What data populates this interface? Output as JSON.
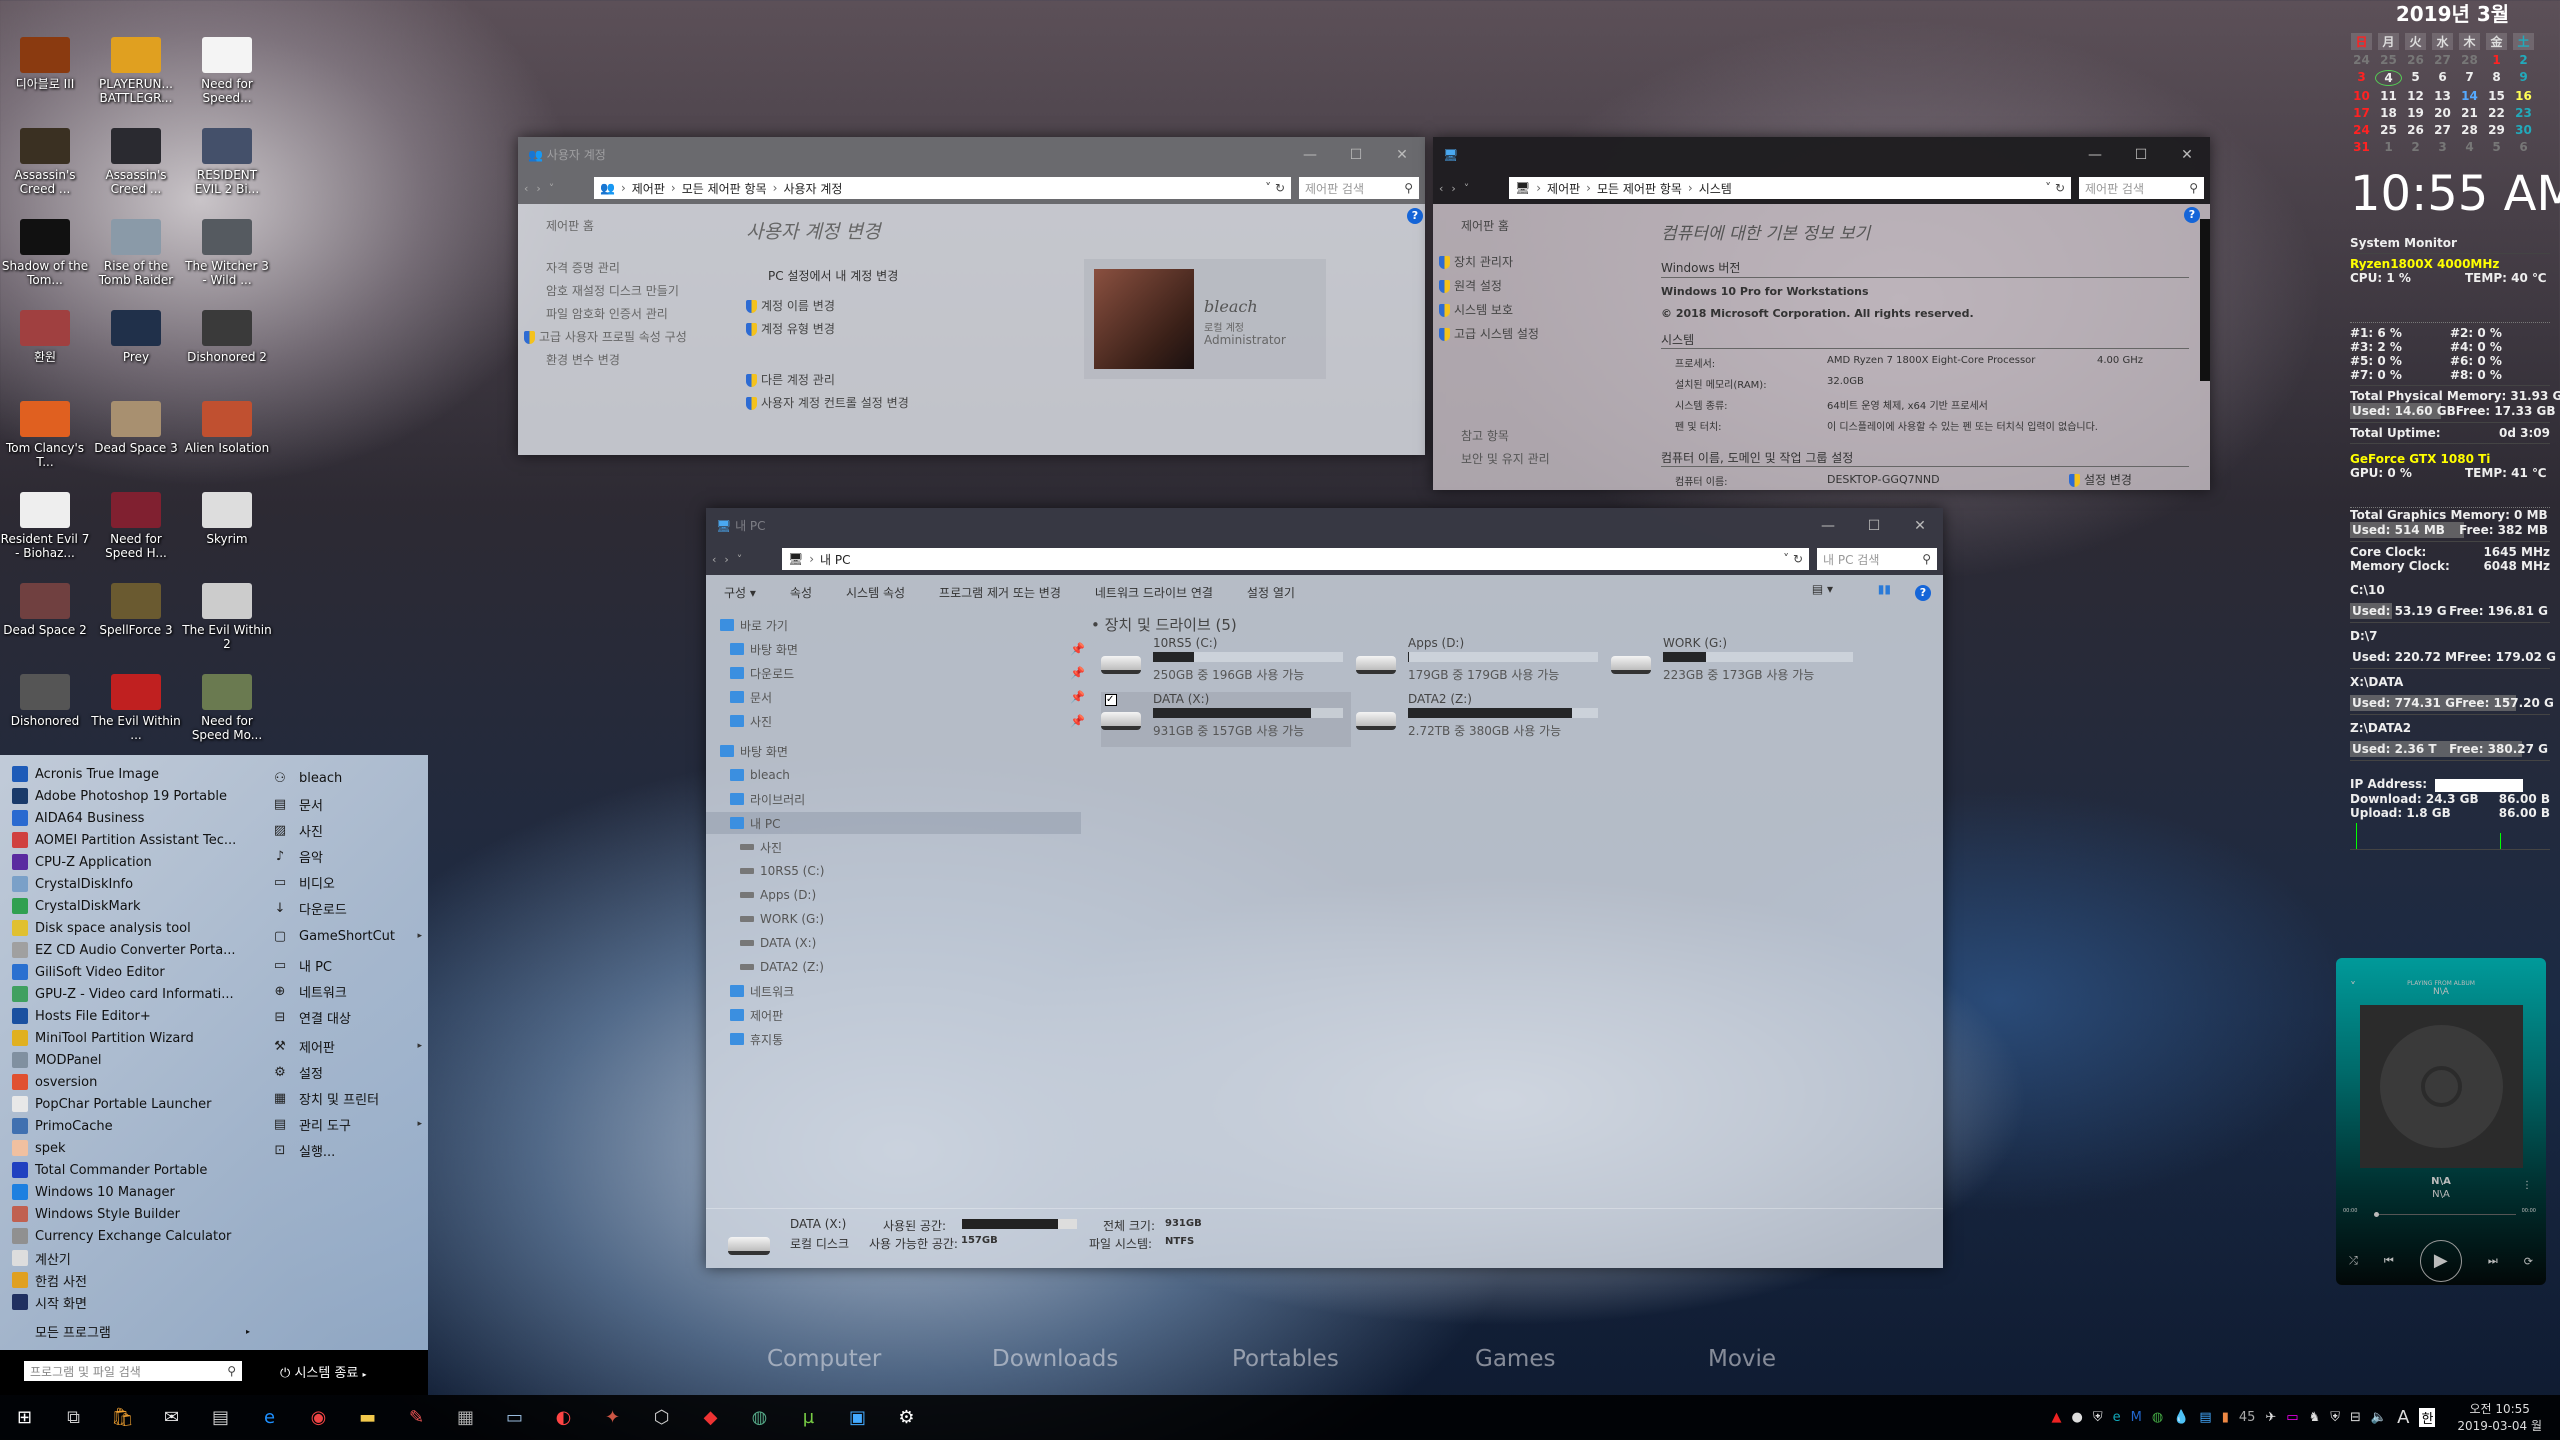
{
  "desktop_icons": [
    {
      "label": "디아블로 III",
      "color": "#8a3a10"
    },
    {
      "label": "PLAYERUN... BATTLEGR...",
      "color": "#e0a020"
    },
    {
      "label": "Need for Speed...",
      "color": "#f4f4f4"
    },
    {
      "label": "Assassin's Creed ...",
      "color": "#3a3022"
    },
    {
      "label": "Assassin's Creed ...",
      "color": "#2a2a30"
    },
    {
      "label": "RESIDENT EVIL 2 Bi...",
      "color": "#44506a"
    },
    {
      "label": "Shadow of the Tom...",
      "color": "#111111"
    },
    {
      "label": "Rise of the Tomb Raider",
      "color": "#8a9aa8"
    },
    {
      "label": "The Witcher 3 - Wild ...",
      "color": "#555a60"
    },
    {
      "label": "환원",
      "color": "#a04040"
    },
    {
      "label": "Prey",
      "color": "#20304a"
    },
    {
      "label": "Dishonored 2",
      "color": "#3a3a3a"
    },
    {
      "label": "Tom Clancy's T...",
      "color": "#e06020"
    },
    {
      "label": "Dead Space 3",
      "color": "#a89070"
    },
    {
      "label": "Alien Isolation",
      "color": "#c05030"
    },
    {
      "label": "Resident Evil 7 - Biohaz...",
      "color": "#eeeeee"
    },
    {
      "label": "Need for Speed H...",
      "color": "#802030"
    },
    {
      "label": "Skyrim",
      "color": "#dddddd"
    },
    {
      "label": "Dead Space 2",
      "color": "#704040"
    },
    {
      "label": "SpellForce 3",
      "color": "#6a5a30"
    },
    {
      "label": "The Evil Within 2",
      "color": "#cccccc"
    },
    {
      "label": "Dishonored",
      "color": "#555555"
    },
    {
      "label": "The Evil Within ...",
      "color": "#c02020"
    },
    {
      "label": "Need for Speed Mo...",
      "color": "#6a7a50"
    }
  ],
  "desktop_labels": [
    "Computer",
    "Downloads",
    "Portables",
    "Games",
    "Movie"
  ],
  "start_menu": {
    "programs": [
      {
        "label": "Acronis True Image",
        "color": "#1e5bb8"
      },
      {
        "label": "Adobe Photoshop 19 Portable",
        "color": "#1a3a6a"
      },
      {
        "label": "AIDA64 Business",
        "color": "#2a6ad0"
      },
      {
        "label": "AOMEI Partition Assistant Tec...",
        "color": "#d04040"
      },
      {
        "label": "CPU-Z Application",
        "color": "#5a2aa0"
      },
      {
        "label": "CrystalDiskInfo",
        "color": "#7aa0c8"
      },
      {
        "label": "CrystalDiskMark",
        "color": "#30a050"
      },
      {
        "label": "Disk space analysis tool",
        "color": "#e0c030"
      },
      {
        "label": "EZ CD Audio Converter Porta...",
        "color": "#a0a0a0"
      },
      {
        "label": "GiliSoft Video Editor",
        "color": "#2a70d0"
      },
      {
        "label": "GPU-Z - Video card Informati...",
        "color": "#40a060"
      },
      {
        "label": "Hosts File Editor+",
        "color": "#1a50a0"
      },
      {
        "label": "MiniTool Partition Wizard",
        "color": "#e0b020"
      },
      {
        "label": "MODPanel",
        "color": "#8090a0"
      },
      {
        "label": "osversion",
        "color": "#e05030"
      },
      {
        "label": "PopChar Portable Launcher",
        "color": "#e8e8e8"
      },
      {
        "label": "PrimoCache",
        "color": "#4070b0"
      },
      {
        "label": "spek",
        "color": "#f0c0a0"
      },
      {
        "label": "Total Commander Portable",
        "color": "#2040c0"
      },
      {
        "label": "Windows 10 Manager",
        "color": "#1e80e0"
      },
      {
        "label": "Windows Style Builder",
        "color": "#c06050"
      },
      {
        "label": "Currency Exchange Calculator",
        "color": "#909090"
      },
      {
        "label": "계산기",
        "color": "#dddddd"
      },
      {
        "label": "한컴 사전",
        "color": "#e0a020"
      },
      {
        "label": "시작 화면",
        "color": "#203060"
      }
    ],
    "all_programs": "모든 프로그램",
    "places": [
      {
        "label": "bleach",
        "icon": "user-icon",
        "glyph": "⚇"
      },
      {
        "label": "문서",
        "icon": "document-icon",
        "glyph": "▤"
      },
      {
        "label": "사진",
        "icon": "picture-icon",
        "glyph": "▨"
      },
      {
        "label": "음악",
        "icon": "music-icon",
        "glyph": "♪"
      },
      {
        "label": "비디오",
        "icon": "video-icon",
        "glyph": "▭"
      },
      {
        "label": "다운로드",
        "icon": "download-icon",
        "glyph": "↓"
      },
      {
        "label": "GameShortCut",
        "icon": "folder-icon",
        "glyph": "▢",
        "arrow": true
      },
      {
        "label": "내 PC",
        "icon": "computer-icon",
        "glyph": "▭"
      },
      {
        "label": "네트워크",
        "icon": "network-icon",
        "glyph": "⊕"
      },
      {
        "label": "연결 대상",
        "icon": "connect-icon",
        "glyph": "⊟"
      },
      {
        "label": "제어판",
        "icon": "wrench-icon",
        "glyph": "⚒",
        "arrow": true
      },
      {
        "label": "설정",
        "icon": "gear-icon",
        "glyph": "⚙"
      },
      {
        "label": "장치 및 프린터",
        "icon": "printer-icon",
        "glyph": "▦"
      },
      {
        "label": "관리 도구",
        "icon": "admin-tools-icon",
        "glyph": "▤",
        "arrow": true
      },
      {
        "label": "실행...",
        "icon": "run-icon",
        "glyph": "⊡"
      }
    ],
    "search_placeholder": "프로그램 및 파일 검색",
    "shutdown": "시스템 종료"
  },
  "window_accounts": {
    "title": "사용자 계정",
    "breadcrumb": [
      "제어판",
      "모든 제어판 항목",
      "사용자 계정"
    ],
    "search_placeholder": "제어판 검색",
    "sidebar": [
      "제어판 홈",
      "자격 증명 관리",
      "암호 재설정 디스크 만들기",
      "파일 암호화 인증서 관리",
      "고급 사용자 프로필 속성 구성",
      "환경 변수 변경"
    ],
    "heading": "사용자 계정 변경",
    "pc_settings_link": "PC 설정에서 내 계정 변경",
    "links": [
      "계정 이름 변경",
      "계정 유형 변경",
      "다른 계정 관리",
      "사용자 계정 컨트롤 설정 변경"
    ],
    "user": {
      "name": "bleach",
      "type": "로컬 계정",
      "role": "Administrator"
    }
  },
  "window_system": {
    "breadcrumb": [
      "제어판",
      "모든 제어판 항목",
      "시스템"
    ],
    "search_placeholder": "제어판 검색",
    "sidebar": [
      "제어판 홈",
      "장치 관리자",
      "원격 설정",
      "시스템 보호",
      "고급 시스템 설정"
    ],
    "see_also": [
      "참고 항목",
      "보안 및 유지 관리"
    ],
    "heading": "컴퓨터에 대한 기본 정보 보기",
    "win_section": "Windows 버전",
    "edition": "Windows 10 Pro for Workstations",
    "copyright": "© 2018 Microsoft Corporation. All rights reserved.",
    "sys_section": "시스템",
    "specs": [
      {
        "k": "프로세서:",
        "v": "AMD Ryzen 7 1800X Eight-Core Processor",
        "v2": "4.00 GHz"
      },
      {
        "k": "설치된 메모리(RAM):",
        "v": "32.0GB",
        "v2": ""
      },
      {
        "k": "시스템 종류:",
        "v": "64비트 운영 체제, x64 기반 프로세서",
        "v2": ""
      },
      {
        "k": "펜 및 터치:",
        "v": "이 디스플레이에 사용할 수 있는 펜 또는 터치식 입력이 없습니다.",
        "v2": ""
      }
    ],
    "name_section": "컴퓨터 이름, 도메인 및 작업 그룹 설정",
    "computer_name_label": "컴퓨터 이름:",
    "computer_name": "DESKTOP-GGQ7NND",
    "change_settings": "설정 변경"
  },
  "window_mypc": {
    "title": "내 PC",
    "breadcrumb": [
      "내 PC"
    ],
    "search_placeholder": "내 PC 검색",
    "ribbon": [
      "구성 ▾",
      "속성",
      "시스템 속성",
      "프로그램 제거 또는 변경",
      "네트워크 드라이브 연결",
      "설정 열기"
    ],
    "tree": [
      {
        "label": "바로 가기",
        "indent": 0
      },
      {
        "label": "바탕 화면",
        "indent": 1,
        "pin": true
      },
      {
        "label": "다운로드",
        "indent": 1,
        "pin": true
      },
      {
        "label": "문서",
        "indent": 1,
        "pin": true
      },
      {
        "label": "사진",
        "indent": 1,
        "pin": true
      },
      {
        "label": "바탕 화면",
        "indent": 0
      },
      {
        "label": "bleach",
        "indent": 1
      },
      {
        "label": "라이브러리",
        "indent": 1
      },
      {
        "label": "내 PC",
        "indent": 1,
        "selected": true
      },
      {
        "label": "사진",
        "indent": 2
      },
      {
        "label": "10RS5 (C:)",
        "indent": 2
      },
      {
        "label": "Apps (D:)",
        "indent": 2
      },
      {
        "label": "WORK (G:)",
        "indent": 2
      },
      {
        "label": "DATA (X:)",
        "indent": 2
      },
      {
        "label": "DATA2 (Z:)",
        "indent": 2
      },
      {
        "label": "네트워크",
        "indent": 1
      },
      {
        "label": "제어판",
        "indent": 1
      },
      {
        "label": "휴지통",
        "indent": 1
      }
    ],
    "group_title": "장치 및 드라이브 (5)",
    "drives": [
      {
        "name": "10RS5 (C:)",
        "free_text": "250GB 중 196GB 사용 가능",
        "used_pct": 21.6
      },
      {
        "name": "Apps (D:)",
        "free_text": "179GB 중 179GB 사용 가능",
        "used_pct": 0.1
      },
      {
        "name": "WORK (G:)",
        "free_text": "223GB 중 173GB 사용 가능",
        "used_pct": 22.4
      },
      {
        "name": "DATA (X:)",
        "free_text": "931GB 중 157GB 사용 가능",
        "used_pct": 83.1,
        "selected": true
      },
      {
        "name": "DATA2 (Z:)",
        "free_text": "2.72TB 중 380GB 사용 가능",
        "used_pct": 86.4
      }
    ],
    "details": {
      "name": "DATA (X:)",
      "type": "로컬 디스크",
      "used_label": "사용된 공간:",
      "free_label": "사용 가능한 공간:",
      "free": "157GB",
      "total_label": "전체 크기:",
      "total": "931GB",
      "fs_label": "파일 시스템:",
      "fs": "NTFS",
      "used_pct": 83.1
    }
  },
  "calendar": {
    "title": "2019년 3월",
    "weekdays": [
      "日",
      "月",
      "火",
      "水",
      "木",
      "金",
      "土"
    ],
    "days": [
      "24",
      "25",
      "26",
      "27",
      "28",
      "1",
      "2",
      "3",
      "4",
      "5",
      "6",
      "7",
      "8",
      "9",
      "10",
      "11",
      "12",
      "13",
      "14",
      "15",
      "16",
      "17",
      "18",
      "19",
      "20",
      "21",
      "22",
      "23",
      "24",
      "25",
      "26",
      "27",
      "28",
      "29",
      "30",
      "31",
      "1",
      "2",
      "3",
      "4",
      "5",
      "6"
    ],
    "today": "4"
  },
  "clock": "10:55 AM",
  "sysmon": {
    "title": "System Monitor",
    "cpu_name": "Ryzen1800X  4000MHz",
    "cpu": "CPU:   1 %",
    "cpu_temp": "TEMP: 40 ℃",
    "cores": [
      "#1:  6 %",
      "#2:  0 %",
      "#3:  2 %",
      "#4:  0 %",
      "#5:  0 %",
      "#6:  0 %",
      "#7:  0 %",
      "#8:  0 %"
    ],
    "mem_total": "Total Physical Memory:  31.93 GB",
    "mem_used": "Used:  14.60 GB",
    "mem_free": "Free: 17.33 GB",
    "mem_used_pct": 45.7,
    "uptime_label": "Total Uptime:",
    "uptime": "0d 3:09",
    "gpu_name": "GeForce GTX 1080 Ti",
    "gpu": "GPU: 0 %",
    "gpu_temp": "TEMP: 41 ℃",
    "gmem_total": "Total Graphics Memory: 0 MB",
    "gmem_used": "Used:  514 MB",
    "gmem_free": "Free: 382 MB",
    "gmem_used_pct": 57,
    "core_clock_label": "Core Clock:",
    "core_clock": "1645 MHz",
    "mem_clock_label": "Memory Clock:",
    "mem_clock": "6048 MHz",
    "disks": [
      {
        "name": "C:\\10",
        "used": "Used:  53.19 G",
        "free": "Free:  196.81 G",
        "pct": 21
      },
      {
        "name": "D:\\7",
        "used": "Used:  220.72 M",
        "free": "Free:  179.02 G",
        "pct": 0
      },
      {
        "name": "X:\\DATA",
        "used": "Used:  774.31 G",
        "free": "Free:  157.20 G",
        "pct": 83
      },
      {
        "name": "Z:\\DATA2",
        "used": "Used:  2.36 T",
        "free": "Free:  380.27 G",
        "pct": 86
      }
    ],
    "ip_label": "IP Address:",
    "download": "Download:  24.3 GB",
    "download_rate": "86.00 B",
    "upload": "Upload:  1.8 GB",
    "upload_rate": "86.00 B"
  },
  "player": {
    "playing_from": "PLAYING FROM ALBUM",
    "album": "N\\A",
    "track": "N\\A",
    "artist": "N\\A",
    "elapsed": "00:00",
    "duration": "00:00",
    "progress": 0
  },
  "tray": {
    "badge": "45",
    "time": "오전 10:55",
    "date": "2019-03-04 월",
    "ime": "한",
    "font": "A"
  },
  "colors": {
    "accent": "#1565d8",
    "monitor_yellow": "#ffff00",
    "player_teal": "#009a9a"
  }
}
